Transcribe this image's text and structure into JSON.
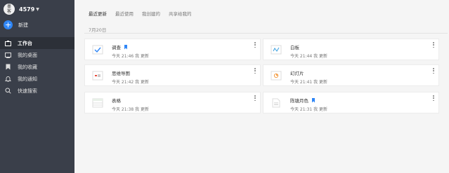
{
  "sidebar": {
    "logo_text": "墨\n客",
    "team_name": "4579",
    "new_label": "新建",
    "items": [
      {
        "label": "工作台",
        "icon": "workbench-icon",
        "active": true
      },
      {
        "label": "我的桌面",
        "icon": "desktop-icon",
        "active": false
      },
      {
        "label": "我的收藏",
        "icon": "bookmark-icon",
        "active": false
      },
      {
        "label": "我的通知",
        "icon": "bell-icon",
        "active": false
      },
      {
        "label": "快速搜索",
        "icon": "search-icon",
        "active": false
      }
    ]
  },
  "tabs": [
    {
      "label": "最近更新",
      "active": true
    },
    {
      "label": "最近使用",
      "active": false
    },
    {
      "label": "我创建的",
      "active": false
    },
    {
      "label": "共享给我的",
      "active": false
    }
  ],
  "date_group": "7月20日",
  "cards": [
    {
      "title": "调查",
      "meta": "今天 21:46 我 更新",
      "icon": "survey-icon",
      "starred": true
    },
    {
      "title": "白板",
      "meta": "今天 21:44 我 更新",
      "icon": "whiteboard-icon",
      "starred": false
    },
    {
      "title": "思维导图",
      "meta": "今天 21:42 我 更新",
      "icon": "mindmap-icon",
      "starred": false
    },
    {
      "title": "幻灯片",
      "meta": "今天 21:41 我 更新",
      "icon": "slides-icon",
      "starred": false
    },
    {
      "title": "表格",
      "meta": "今天 21:38 我 更新",
      "icon": "sheet-icon",
      "starred": false
    },
    {
      "title": "陈塘月色",
      "meta": "今天 21:31 我 更新",
      "icon": "document-icon",
      "starred": true
    }
  ],
  "colors": {
    "sidebar": "#3a3f4a",
    "accent": "#2f86f6",
    "background": "#f5f5f5"
  }
}
